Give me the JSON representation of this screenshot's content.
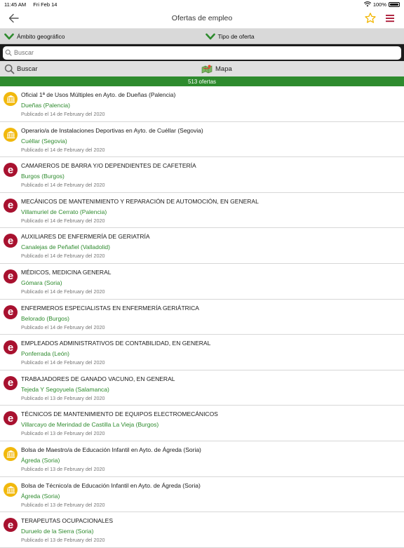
{
  "status": {
    "time": "11:45 AM",
    "date": "Fri Feb 14",
    "battery": "100%"
  },
  "nav": {
    "title": "Ofertas de empleo"
  },
  "filters": {
    "geo": "Ámbito geográfico",
    "type": "Tipo de oferta"
  },
  "search": {
    "placeholder": "Buscar"
  },
  "actions": {
    "search_label": "Buscar",
    "map_label": "Mapa"
  },
  "count": {
    "label": "513 ofertas"
  },
  "colors": {
    "accent_green": "#2e8b2e",
    "ecyl_red": "#a8112f",
    "ayto_yellow": "#f1b80c",
    "star_yellow": "#f2b600",
    "menu_red": "#a8112f"
  },
  "offers": [
    {
      "icon": "ayto-icon",
      "title": "Oficial 1ª de Usos Múltiples en Ayto. de Dueñas (Palencia)",
      "location": "Dueñas (Palencia)",
      "date": "Publicado el 14 de February del 2020"
    },
    {
      "icon": "ayto-icon",
      "title": "Operario/a de Instalaciones Deportivas en Ayto. de Cuéllar (Segovia)",
      "location": "Cuéllar (Segovia)",
      "date": "Publicado el 14 de February del 2020"
    },
    {
      "icon": "ecyl-icon",
      "title": "CAMAREROS DE BARRA Y/O DEPENDIENTES DE CAFETERÍA",
      "location": "Burgos (Burgos)",
      "date": "Publicado el 14 de February del 2020"
    },
    {
      "icon": "ecyl-icon",
      "title": "MECÁNICOS DE MANTENIMIENTO Y REPARACIÓN DE AUTOMOCIÓN, EN GENERAL",
      "location": "Villamuriel de Cerrato (Palencia)",
      "date": "Publicado el 14 de February del 2020"
    },
    {
      "icon": "ecyl-icon",
      "title": "AUXILIARES DE ENFERMERÍA DE GERIATRÍA",
      "location": "Canalejas de Peñafiel (Valladolid)",
      "date": "Publicado el 14 de February del 2020"
    },
    {
      "icon": "ecyl-icon",
      "title": "MÉDICOS, MEDICINA GENERAL",
      "location": "Gómara (Soria)",
      "date": "Publicado el 14 de February del 2020"
    },
    {
      "icon": "ecyl-icon",
      "title": "ENFERMEROS ESPECIALISTAS EN ENFERMERÍA GERIÁTRICA",
      "location": "Belorado (Burgos)",
      "date": "Publicado el 14 de February del 2020"
    },
    {
      "icon": "ecyl-icon",
      "title": "EMPLEADOS ADMINISTRATIVOS DE CONTABILIDAD, EN GENERAL",
      "location": "Ponferrada (León)",
      "date": "Publicado el 14 de February del 2020"
    },
    {
      "icon": "ecyl-icon",
      "title": "TRABAJADORES DE GANADO VACUNO, EN GENERAL",
      "location": "Tejeda Y Segoyuela (Salamanca)",
      "date": "Publicado el 13 de February del 2020"
    },
    {
      "icon": "ecyl-icon",
      "title": "TÉCNICOS DE MANTENIMIENTO DE EQUIPOS ELECTROMECÁNICOS",
      "location": "Villarcayo de Merindad de Castilla La Vieja (Burgos)",
      "date": "Publicado el 13 de February del 2020"
    },
    {
      "icon": "ayto-icon",
      "title": "Bolsa de Maestro/a de Educación Infantil en Ayto. de Ágreda (Soria)",
      "location": "Ágreda (Soria)",
      "date": "Publicado el 13 de February del 2020"
    },
    {
      "icon": "ayto-icon",
      "title": "Bolsa de Técnico/a de Educación Infantil en Ayto. de Ágreda (Soria)",
      "location": "Ágreda (Soria)",
      "date": "Publicado el 13 de February del 2020"
    },
    {
      "icon": "ecyl-icon",
      "title": "TERAPEUTAS OCUPACIONALES",
      "location": "Duruelo de la Sierra (Soria)",
      "date": "Publicado el 13 de February del 2020"
    }
  ]
}
